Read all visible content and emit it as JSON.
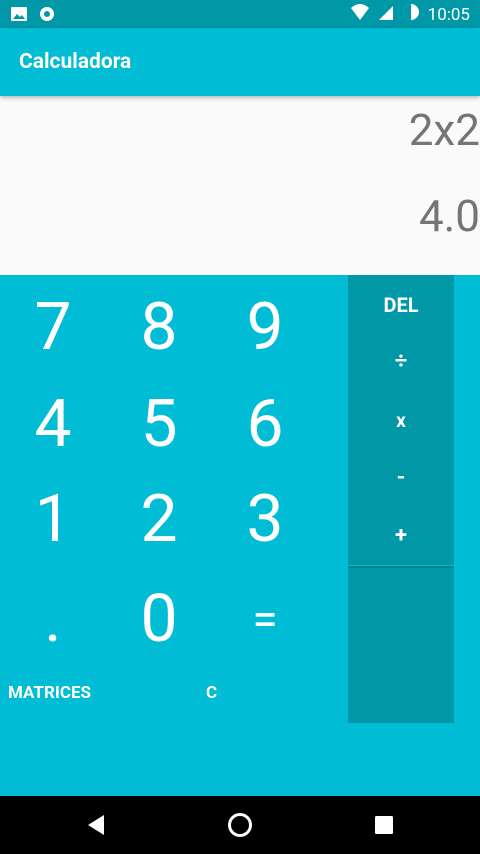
{
  "status_bar": {
    "time": "10:05"
  },
  "app_bar": {
    "title": "Calculadora"
  },
  "display": {
    "expression": "2x2",
    "result": "4.0"
  },
  "keys": {
    "k7": "7",
    "k8": "8",
    "k9": "9",
    "k4": "4",
    "k5": "5",
    "k6": "6",
    "k1": "1",
    "k2": "2",
    "k3": "3",
    "dot": ".",
    "k0": "0",
    "equals": "="
  },
  "actions": {
    "matrices": "MATRICES",
    "clear": "C"
  },
  "operators": {
    "del": "DEL",
    "divide": "÷",
    "multiply": "x",
    "minus": "-",
    "plus": "+"
  },
  "colors": {
    "primary": "#00BCD4",
    "primary_dark": "#0097A7",
    "display_bg": "#FAFAFA",
    "display_text": "#757575"
  }
}
